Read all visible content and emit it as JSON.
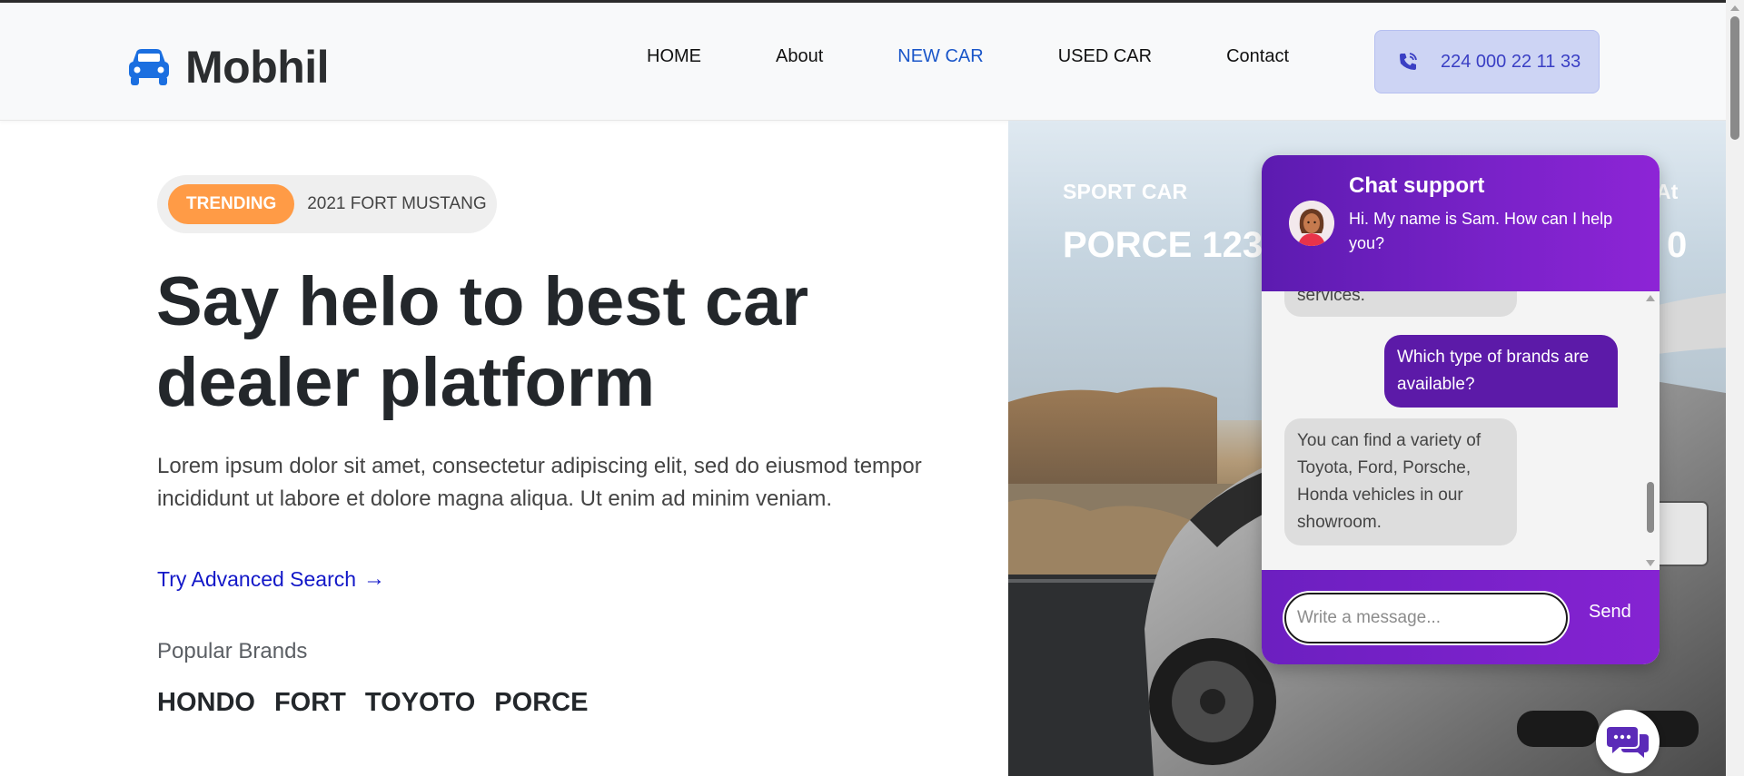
{
  "header": {
    "logo_text": "Mobhil",
    "nav": [
      "HOME",
      "About",
      "NEW CAR",
      "USED CAR",
      "Contact"
    ],
    "active_nav": "NEW CAR",
    "phone": "224 000 22 11 33"
  },
  "hero": {
    "badge": "TRENDING",
    "badge_text": "2021 FORT MUSTANG",
    "title_line1": "Say helo to best car",
    "title_line2": "dealer platform",
    "description": "Lorem ipsum dolor sit amet, consectetur adipiscing elit, sed do eiusmod tempor incididunt ut labore et dolore magna aliqua. Ut enim ad minim veniam.",
    "advanced_search": "Try Advanced Search",
    "brands_label": "Popular Brands",
    "brands": [
      "HONDO",
      "FORT",
      "TOYOTO",
      "PORCE"
    ]
  },
  "feature": {
    "category": "SPORT CAR",
    "car_name": "PORCE 123 G",
    "at_label": "At",
    "price_tail": "0"
  },
  "chat": {
    "title": "Chat support",
    "greeting": "Hi. My name is Sam. How can I help you?",
    "messages": [
      {
        "from": "bot",
        "text": "services."
      },
      {
        "from": "user",
        "text": "Which type of brands are available?"
      },
      {
        "from": "bot",
        "text": "You can find a variety of Toyota, Ford, Porsche, Honda vehicles in our showroom."
      }
    ],
    "input_placeholder": "Write a message...",
    "send_label": "Send"
  },
  "colors": {
    "accent_blue": "#1a56c9",
    "link_blue": "#1318c8",
    "badge_orange": "#ff9b46",
    "chat_purple": "#6c1fc0"
  }
}
